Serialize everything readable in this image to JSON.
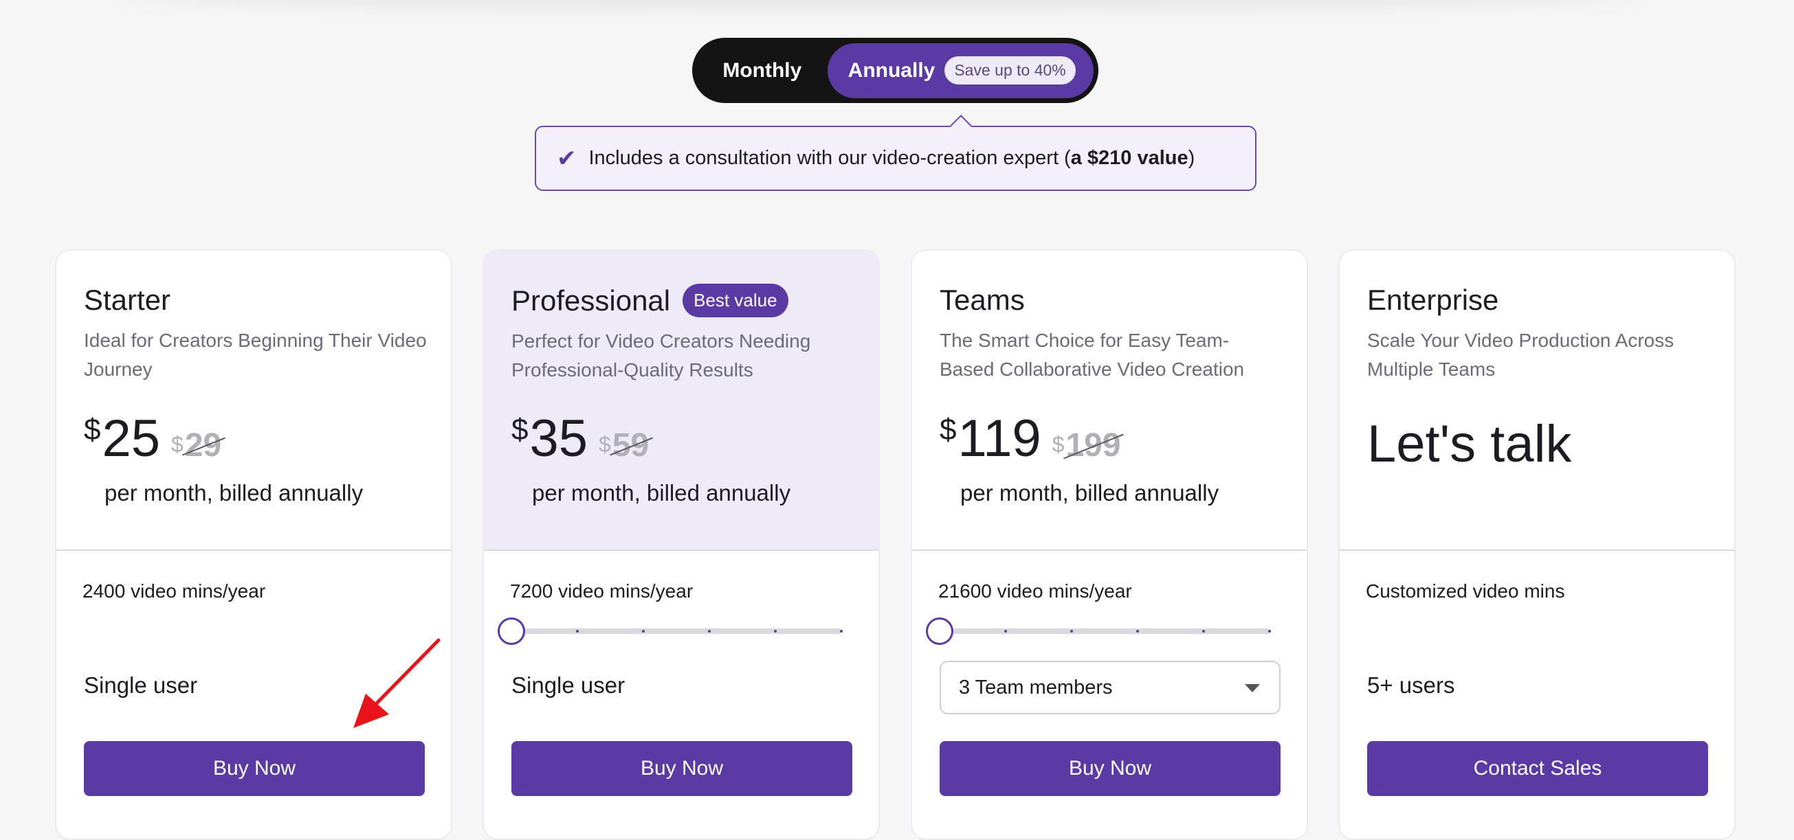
{
  "billing_toggle": {
    "monthly_label": "Monthly",
    "annually_label": "Annually",
    "save_badge": "Save up to 40%",
    "selected": "Annually"
  },
  "callout": {
    "text_before": "Includes a consultation with our video-creation expert (",
    "text_bold": "a $210 value",
    "text_after": ")",
    "icon": "check-icon"
  },
  "plans": [
    {
      "name": "Starter",
      "description": "Ideal for Creators Beginning Their Video Journey",
      "currency": "$",
      "price": "25",
      "old_currency": "$",
      "old_price": "29",
      "billing_note": "per month, billed annually",
      "minutes": "2400 video mins/year",
      "users": "Single user",
      "cta": "Buy Now"
    },
    {
      "name": "Professional",
      "badge": "Best value",
      "description": "Perfect for Video Creators Needing Professional-Quality Results",
      "currency": "$",
      "price": "35",
      "old_currency": "$",
      "old_price": "59",
      "billing_note": "per month, billed annually",
      "minutes": "7200 video mins/year",
      "slider_level": 0,
      "users": "Single user",
      "cta": "Buy Now"
    },
    {
      "name": "Teams",
      "description": "The Smart Choice for Easy Team-Based Collaborative Video Creation",
      "currency": "$",
      "price": "119",
      "old_currency": "$",
      "old_price": "199",
      "billing_note": "per month, billed annually",
      "minutes": "21600 video mins/year",
      "slider_level": 0,
      "team_select_value": "3 Team members",
      "cta": "Buy Now"
    },
    {
      "name": "Enterprise",
      "description": "Scale Your Video Production Across Multiple Teams",
      "price_text": "Let's talk",
      "minutes": "Customized video mins",
      "users": "5+ users",
      "cta": "Contact Sales"
    }
  ],
  "colors": {
    "accent": "#5a3aa3",
    "highlight_bg": "#efeaf8",
    "toggle_bg": "#141414",
    "annotation_arrow": "#e8141a"
  }
}
